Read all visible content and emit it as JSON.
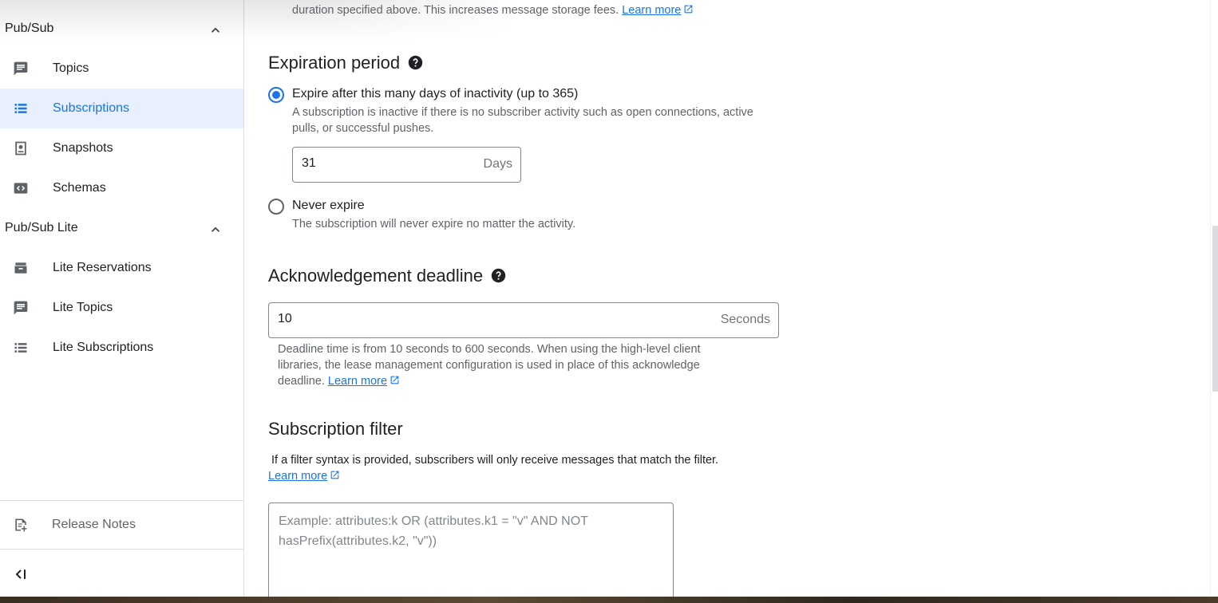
{
  "sidebar": {
    "group1": {
      "label": "Pub/Sub"
    },
    "items1": [
      {
        "label": "Topics",
        "icon": "topics-icon"
      },
      {
        "label": "Subscriptions",
        "icon": "subscriptions-icon",
        "active": true
      },
      {
        "label": "Snapshots",
        "icon": "snapshots-icon"
      },
      {
        "label": "Schemas",
        "icon": "schemas-icon"
      }
    ],
    "group2": {
      "label": "Pub/Sub Lite"
    },
    "items2": [
      {
        "label": "Lite Reservations",
        "icon": "lite-reservations-icon"
      },
      {
        "label": "Lite Topics",
        "icon": "lite-topics-icon"
      },
      {
        "label": "Lite Subscriptions",
        "icon": "lite-subscriptions-icon"
      }
    ],
    "release_notes": "Release Notes"
  },
  "top_fragment": {
    "text": "duration specified above. This increases message storage fees.",
    "link": "Learn more"
  },
  "expiration": {
    "title": "Expiration period",
    "option1_label": "Expire after this many days of inactivity (up to 365)",
    "option1_desc_line1": "A subscription is inactive if there is no subscriber activity such as open connections, active",
    "option1_desc_line2": "pulls, or successful pushes.",
    "days_value": "31",
    "days_suffix": "Days",
    "option2_label": "Never expire",
    "option2_desc": "The subscription will never expire no matter the activity.",
    "selected": "option1"
  },
  "ack": {
    "title": "Acknowledgement deadline",
    "value": "10",
    "suffix": "Seconds",
    "desc_line1": "Deadline time is from 10 seconds to 600 seconds. When using the high-level client",
    "desc_line2": "libraries, the lease management configuration is used in place of this acknowledge",
    "desc_line3": "deadline.",
    "link": "Learn more"
  },
  "filter": {
    "title": "Subscription filter",
    "desc": "If a filter syntax is provided, subscribers will only receive messages that match the filter.",
    "link": "Learn more",
    "placeholder": "Example: attributes:k OR (attributes.k1 = \"v\" AND NOT hasPrefix(attributes.k2, \"v\"))"
  },
  "colors": {
    "accent": "#1a73e8",
    "active_bg": "#e8f0fe",
    "text": "#202124",
    "muted": "#5f6368"
  }
}
